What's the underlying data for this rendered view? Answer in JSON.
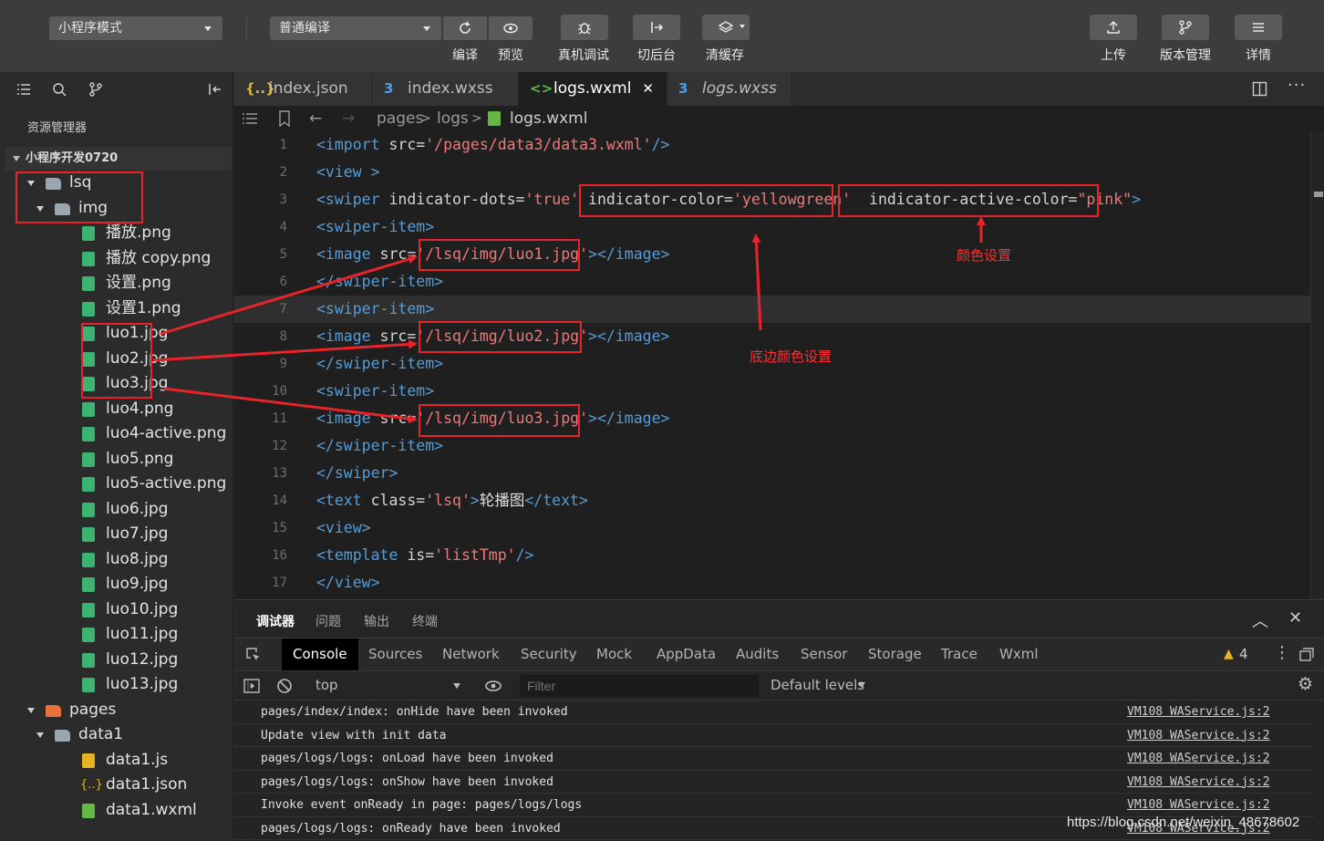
{
  "toolbar": {
    "mode_select": "小程序模式",
    "compile_select": "普通编译",
    "buttons": {
      "compile": "编译",
      "preview": "预览",
      "remote_debug": "真机调试",
      "background": "切后台",
      "clear_cache": "清缓存",
      "upload": "上传",
      "version": "版本管理",
      "details": "详情"
    }
  },
  "explorer": {
    "title": "资源管理器",
    "project": "小程序开发0720",
    "tree": [
      {
        "label": "lsq",
        "depth": 0,
        "type": "folder",
        "open": true
      },
      {
        "label": "img",
        "depth": 1,
        "type": "folder-img",
        "open": true
      },
      {
        "label": "播放.png",
        "depth": 2,
        "type": "image"
      },
      {
        "label": "播放 copy.png",
        "depth": 2,
        "type": "image"
      },
      {
        "label": "设置.png",
        "depth": 2,
        "type": "image"
      },
      {
        "label": "设置1.png",
        "depth": 2,
        "type": "image"
      },
      {
        "label": "luo1.jpg",
        "depth": 2,
        "type": "image"
      },
      {
        "label": "luo2.jpg",
        "depth": 2,
        "type": "image"
      },
      {
        "label": "luo3.jpg",
        "depth": 2,
        "type": "image"
      },
      {
        "label": "luo4.png",
        "depth": 2,
        "type": "image"
      },
      {
        "label": "luo4-active.png",
        "depth": 2,
        "type": "image"
      },
      {
        "label": "luo5.png",
        "depth": 2,
        "type": "image"
      },
      {
        "label": "luo5-active.png",
        "depth": 2,
        "type": "image"
      },
      {
        "label": "luo6.jpg",
        "depth": 2,
        "type": "image"
      },
      {
        "label": "luo7.jpg",
        "depth": 2,
        "type": "image"
      },
      {
        "label": "luo8.jpg",
        "depth": 2,
        "type": "image"
      },
      {
        "label": "luo9.jpg",
        "depth": 2,
        "type": "image"
      },
      {
        "label": "luo10.jpg",
        "depth": 2,
        "type": "image"
      },
      {
        "label": "luo11.jpg",
        "depth": 2,
        "type": "image"
      },
      {
        "label": "luo12.jpg",
        "depth": 2,
        "type": "image"
      },
      {
        "label": "luo13.jpg",
        "depth": 2,
        "type": "image"
      },
      {
        "label": "pages",
        "depth": 0,
        "type": "folder-pages",
        "open": true
      },
      {
        "label": "data1",
        "depth": 1,
        "type": "folder",
        "open": true
      },
      {
        "label": "data1.js",
        "depth": 2,
        "type": "js"
      },
      {
        "label": "data1.json",
        "depth": 2,
        "type": "json"
      },
      {
        "label": "data1.wxml",
        "depth": 2,
        "type": "wxml"
      }
    ]
  },
  "editor": {
    "tabs": [
      {
        "label": "index.json",
        "icon": "{..}",
        "icon_color": "#e6b422",
        "active": false,
        "italic": false
      },
      {
        "label": "index.wxss",
        "icon": "3",
        "icon_color": "#4a9eea",
        "active": false,
        "italic": false
      },
      {
        "label": "logs.wxml",
        "icon": "<>",
        "icon_color": "#65b844",
        "active": true,
        "italic": false
      },
      {
        "label": "logs.wxss",
        "icon": "3",
        "icon_color": "#4a9eea",
        "active": false,
        "italic": true
      }
    ],
    "breadcrumb": {
      "part1": "pages",
      "part2": "logs",
      "file": "logs.wxml"
    },
    "cursor_line": 7,
    "lines": [
      [
        [
          "tag",
          "<import "
        ],
        [
          "att",
          "src="
        ],
        [
          "str",
          "'/pages/data3/data3.wxml'"
        ],
        [
          "tag",
          "/>"
        ]
      ],
      [
        [
          "tag",
          "<view >"
        ]
      ],
      [
        [
          "tag",
          "<swiper "
        ],
        [
          "att",
          "indicator-dots="
        ],
        [
          "str",
          "'true'"
        ],
        [
          "att",
          " indicator-color="
        ],
        [
          "str",
          "'yellowgreen'"
        ],
        [
          "att",
          "  indicator-active-color="
        ],
        [
          "str",
          "\"pink\""
        ],
        [
          "tag",
          ">"
        ]
      ],
      [
        [
          "tag",
          "<swiper-item>"
        ]
      ],
      [
        [
          "tag",
          "<image "
        ],
        [
          "att",
          "src="
        ],
        [
          "str",
          "'/lsq/img/luo1.jpg'"
        ],
        [
          "tag",
          "></image>"
        ]
      ],
      [
        [
          "tag",
          "</swiper-item>"
        ]
      ],
      [
        [
          "tag",
          "<swiper-item>"
        ]
      ],
      [
        [
          "tag",
          "<image "
        ],
        [
          "att",
          "src="
        ],
        [
          "str",
          "'/lsq/img/luo2.jpg'"
        ],
        [
          "tag",
          "></image>"
        ]
      ],
      [
        [
          "tag",
          "</swiper-item>"
        ]
      ],
      [
        [
          "tag",
          "<swiper-item>"
        ]
      ],
      [
        [
          "tag",
          "<image "
        ],
        [
          "att",
          "src="
        ],
        [
          "str",
          "'/lsq/img/luo3.jpg'"
        ],
        [
          "tag",
          "></image>"
        ]
      ],
      [
        [
          "tag",
          "</swiper-item>"
        ]
      ],
      [
        [
          "tag",
          "</swiper>"
        ]
      ],
      [
        [
          "tag",
          "<text "
        ],
        [
          "att",
          "class="
        ],
        [
          "str",
          "'lsq'"
        ],
        [
          "tag",
          ">"
        ],
        [
          "txt",
          "轮播图"
        ],
        [
          "tag",
          "</text>"
        ]
      ],
      [
        [
          "tag",
          "<view>"
        ]
      ],
      [
        [
          "tag",
          "<template "
        ],
        [
          "att",
          "is="
        ],
        [
          "str",
          "'listTmp'"
        ],
        [
          "tag",
          "/>"
        ]
      ],
      [
        [
          "tag",
          "</view>"
        ]
      ]
    ]
  },
  "annotations": {
    "color_setting": "颜色设置",
    "bottom_color_setting": "底边颜色设置"
  },
  "debugger": {
    "panel_tabs": [
      "调试器",
      "问题",
      "输出",
      "终端"
    ],
    "devtools_tabs": [
      "Console",
      "Sources",
      "Network",
      "Security",
      "Mock",
      "AppData",
      "Audits",
      "Sensor",
      "Storage",
      "Trace",
      "Wxml"
    ],
    "warning_count": "4",
    "context": "top",
    "filter_placeholder": "Filter",
    "levels": "Default levels",
    "logs": [
      {
        "msg": "pages/index/index: onHide have been invoked",
        "src": "VM108 WAService.js:2"
      },
      {
        "msg": "Update view with init data",
        "src": "VM108 WAService.js:2"
      },
      {
        "msg": "pages/logs/logs: onLoad have been invoked",
        "src": "VM108 WAService.js:2"
      },
      {
        "msg": "pages/logs/logs: onShow have been invoked",
        "src": "VM108 WAService.js:2"
      },
      {
        "msg": "Invoke event onReady in page: pages/logs/logs",
        "src": "VM108 WAService.js:2"
      },
      {
        "msg": "pages/logs/logs: onReady have been invoked",
        "src": "VM108 WAService.js:2"
      }
    ]
  },
  "watermark": "https://blog.csdn.net/weixin_48678602",
  "colors": {
    "annotation": "#e8232a",
    "accent_green": "#65b844",
    "folder": "#9aa7b1"
  }
}
